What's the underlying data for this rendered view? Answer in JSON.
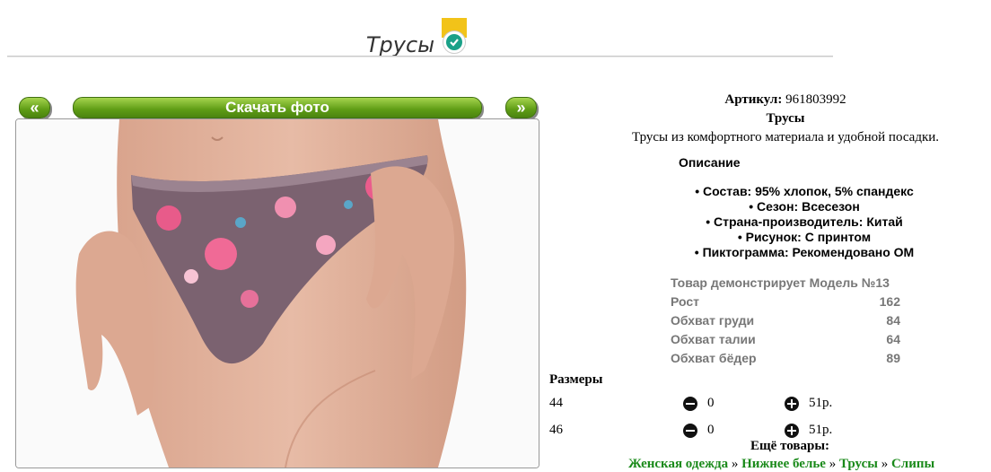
{
  "header": {
    "title": "Трусы"
  },
  "gallery": {
    "prev_label": "«",
    "download_label": "Скачать фото",
    "next_label": "»"
  },
  "product": {
    "article_label": "Артикул:",
    "article_value": "961803992",
    "name": "Трусы",
    "short_description": "Трусы из комфортного материала и удобной посадки.",
    "description_title": "Описание",
    "properties": [
      "Состав: 95% хлопок, 5% спандекс",
      "Сезон: Всесезон",
      "Страна-производитель: Китай",
      "Рисунок: С принтом",
      "Пиктограмма: Рекомендовано ОМ"
    ]
  },
  "model": {
    "title": "Товар демонстрирует Модель №13",
    "rows": [
      {
        "label": "Рост",
        "value": "162"
      },
      {
        "label": "Обхват груди",
        "value": "84"
      },
      {
        "label": "Обхват талии",
        "value": "64"
      },
      {
        "label": "Обхват бёдер",
        "value": "89"
      }
    ]
  },
  "sizes": {
    "label": "Размеры",
    "items": [
      {
        "size": "44",
        "qty": "0",
        "price": "51р."
      },
      {
        "size": "46",
        "qty": "0",
        "price": "51р."
      }
    ]
  },
  "more": {
    "label": "Ещё товары:",
    "breadcrumbs": [
      "Женская одежда",
      "Нижнее белье",
      "Трусы",
      "Слипы"
    ],
    "separator": "»"
  }
}
